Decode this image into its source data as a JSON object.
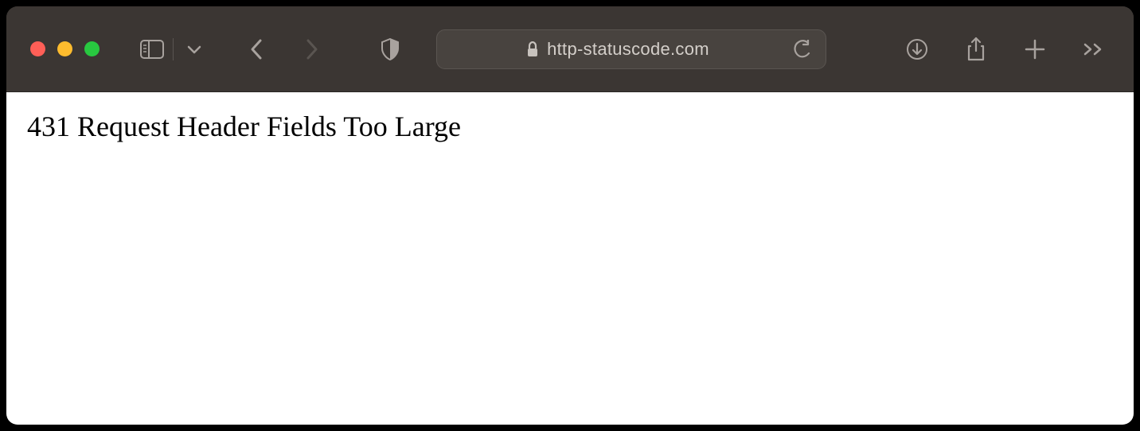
{
  "window": {
    "traffic_lights": {
      "close": "close",
      "minimize": "minimize",
      "maximize": "maximize"
    }
  },
  "toolbar": {
    "sidebar_toggle": "sidebar",
    "dropdown": "tab-groups",
    "back": "back",
    "forward": "forward",
    "privacy_shield": "privacy-report"
  },
  "address_bar": {
    "lock": "secure",
    "url": "http-statuscode.com",
    "reload": "reload"
  },
  "actions": {
    "downloads": "downloads",
    "share": "share",
    "new_tab": "new-tab",
    "overflow": "more"
  },
  "page": {
    "body_text": "431 Request Header Fields Too Large"
  }
}
